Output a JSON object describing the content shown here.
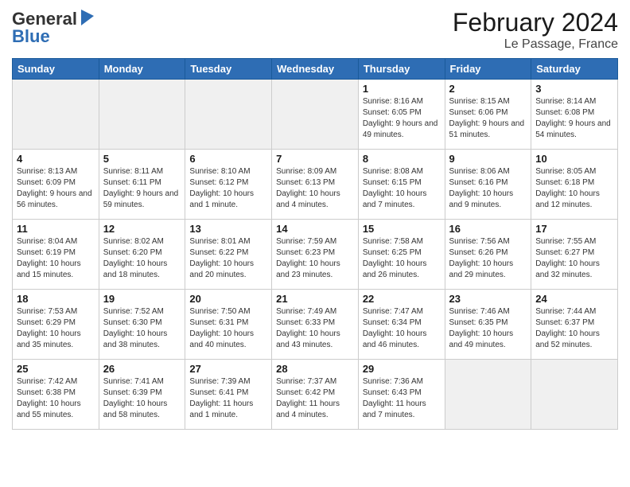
{
  "header": {
    "logo_general": "General",
    "logo_blue": "Blue",
    "title": "February 2024",
    "subtitle": "Le Passage, France"
  },
  "days_of_week": [
    "Sunday",
    "Monday",
    "Tuesday",
    "Wednesday",
    "Thursday",
    "Friday",
    "Saturday"
  ],
  "weeks": [
    [
      {
        "day": "",
        "info": ""
      },
      {
        "day": "",
        "info": ""
      },
      {
        "day": "",
        "info": ""
      },
      {
        "day": "",
        "info": ""
      },
      {
        "day": "1",
        "info": "Sunrise: 8:16 AM\nSunset: 6:05 PM\nDaylight: 9 hours and 49 minutes."
      },
      {
        "day": "2",
        "info": "Sunrise: 8:15 AM\nSunset: 6:06 PM\nDaylight: 9 hours and 51 minutes."
      },
      {
        "day": "3",
        "info": "Sunrise: 8:14 AM\nSunset: 6:08 PM\nDaylight: 9 hours and 54 minutes."
      }
    ],
    [
      {
        "day": "4",
        "info": "Sunrise: 8:13 AM\nSunset: 6:09 PM\nDaylight: 9 hours and 56 minutes."
      },
      {
        "day": "5",
        "info": "Sunrise: 8:11 AM\nSunset: 6:11 PM\nDaylight: 9 hours and 59 minutes."
      },
      {
        "day": "6",
        "info": "Sunrise: 8:10 AM\nSunset: 6:12 PM\nDaylight: 10 hours and 1 minute."
      },
      {
        "day": "7",
        "info": "Sunrise: 8:09 AM\nSunset: 6:13 PM\nDaylight: 10 hours and 4 minutes."
      },
      {
        "day": "8",
        "info": "Sunrise: 8:08 AM\nSunset: 6:15 PM\nDaylight: 10 hours and 7 minutes."
      },
      {
        "day": "9",
        "info": "Sunrise: 8:06 AM\nSunset: 6:16 PM\nDaylight: 10 hours and 9 minutes."
      },
      {
        "day": "10",
        "info": "Sunrise: 8:05 AM\nSunset: 6:18 PM\nDaylight: 10 hours and 12 minutes."
      }
    ],
    [
      {
        "day": "11",
        "info": "Sunrise: 8:04 AM\nSunset: 6:19 PM\nDaylight: 10 hours and 15 minutes."
      },
      {
        "day": "12",
        "info": "Sunrise: 8:02 AM\nSunset: 6:20 PM\nDaylight: 10 hours and 18 minutes."
      },
      {
        "day": "13",
        "info": "Sunrise: 8:01 AM\nSunset: 6:22 PM\nDaylight: 10 hours and 20 minutes."
      },
      {
        "day": "14",
        "info": "Sunrise: 7:59 AM\nSunset: 6:23 PM\nDaylight: 10 hours and 23 minutes."
      },
      {
        "day": "15",
        "info": "Sunrise: 7:58 AM\nSunset: 6:25 PM\nDaylight: 10 hours and 26 minutes."
      },
      {
        "day": "16",
        "info": "Sunrise: 7:56 AM\nSunset: 6:26 PM\nDaylight: 10 hours and 29 minutes."
      },
      {
        "day": "17",
        "info": "Sunrise: 7:55 AM\nSunset: 6:27 PM\nDaylight: 10 hours and 32 minutes."
      }
    ],
    [
      {
        "day": "18",
        "info": "Sunrise: 7:53 AM\nSunset: 6:29 PM\nDaylight: 10 hours and 35 minutes."
      },
      {
        "day": "19",
        "info": "Sunrise: 7:52 AM\nSunset: 6:30 PM\nDaylight: 10 hours and 38 minutes."
      },
      {
        "day": "20",
        "info": "Sunrise: 7:50 AM\nSunset: 6:31 PM\nDaylight: 10 hours and 40 minutes."
      },
      {
        "day": "21",
        "info": "Sunrise: 7:49 AM\nSunset: 6:33 PM\nDaylight: 10 hours and 43 minutes."
      },
      {
        "day": "22",
        "info": "Sunrise: 7:47 AM\nSunset: 6:34 PM\nDaylight: 10 hours and 46 minutes."
      },
      {
        "day": "23",
        "info": "Sunrise: 7:46 AM\nSunset: 6:35 PM\nDaylight: 10 hours and 49 minutes."
      },
      {
        "day": "24",
        "info": "Sunrise: 7:44 AM\nSunset: 6:37 PM\nDaylight: 10 hours and 52 minutes."
      }
    ],
    [
      {
        "day": "25",
        "info": "Sunrise: 7:42 AM\nSunset: 6:38 PM\nDaylight: 10 hours and 55 minutes."
      },
      {
        "day": "26",
        "info": "Sunrise: 7:41 AM\nSunset: 6:39 PM\nDaylight: 10 hours and 58 minutes."
      },
      {
        "day": "27",
        "info": "Sunrise: 7:39 AM\nSunset: 6:41 PM\nDaylight: 11 hours and 1 minute."
      },
      {
        "day": "28",
        "info": "Sunrise: 7:37 AM\nSunset: 6:42 PM\nDaylight: 11 hours and 4 minutes."
      },
      {
        "day": "29",
        "info": "Sunrise: 7:36 AM\nSunset: 6:43 PM\nDaylight: 11 hours and 7 minutes."
      },
      {
        "day": "",
        "info": ""
      },
      {
        "day": "",
        "info": ""
      }
    ]
  ]
}
